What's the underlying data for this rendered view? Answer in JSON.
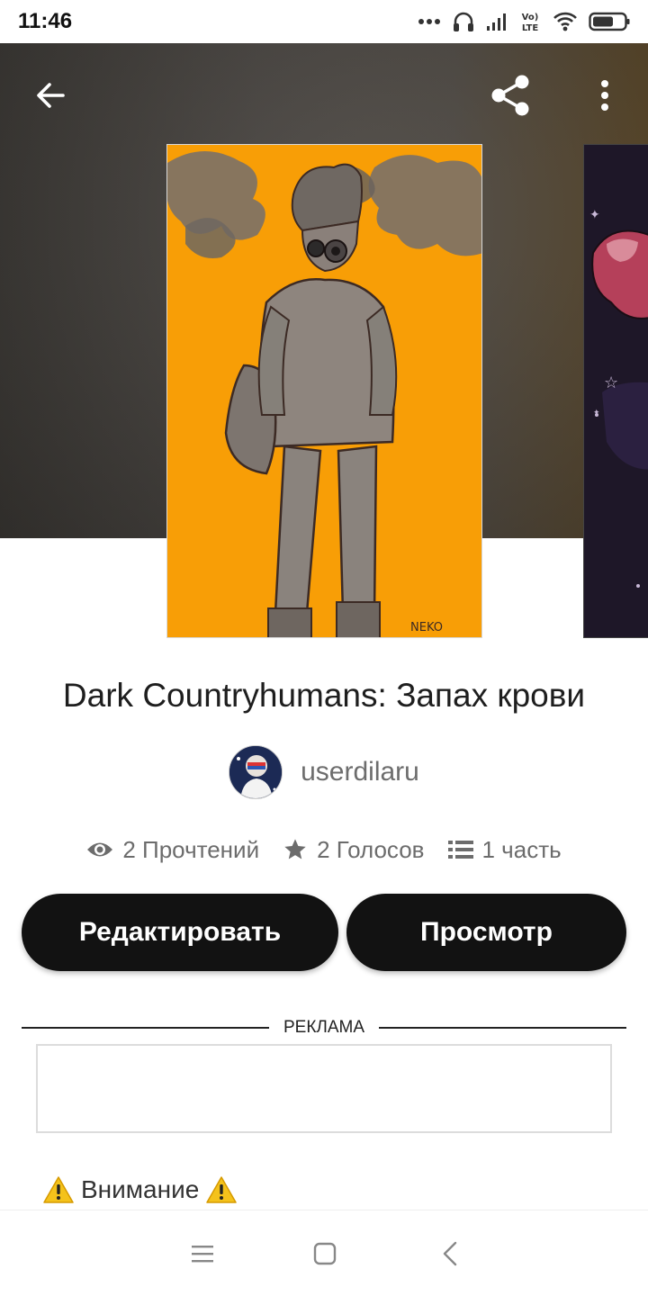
{
  "status_bar": {
    "time": "11:46",
    "icons": [
      "more-dots-icon",
      "headphones-icon",
      "signal-icon",
      "volte-lte-icon",
      "wifi-icon",
      "battery-icon"
    ],
    "volte_line1": "Vo)",
    "volte_line2": "LTE"
  },
  "toolbar": {
    "icons": [
      "back-arrow-icon",
      "share-icon",
      "more-vertical-icon"
    ]
  },
  "story": {
    "title": "Dark Countryhumans: Запах крови",
    "author": "userdilaru",
    "cover_signature": "NEKO"
  },
  "stats": {
    "reads": "2 Прочтений",
    "votes": "2 Голосов",
    "parts": "1 часть"
  },
  "actions": {
    "edit_label": "Редактировать",
    "preview_label": "Просмотр"
  },
  "ad": {
    "label": "РЕКЛАМА"
  },
  "warning": {
    "text": "Внимание"
  },
  "nav_bar": {
    "icons": [
      "menu-icon",
      "home-square-icon",
      "back-chevron-icon"
    ]
  },
  "colors": {
    "cover_background": "#f89e06",
    "button_background": "#121212",
    "muted_text": "#6c6c6c",
    "warning_yellow": "#f4c21b"
  }
}
